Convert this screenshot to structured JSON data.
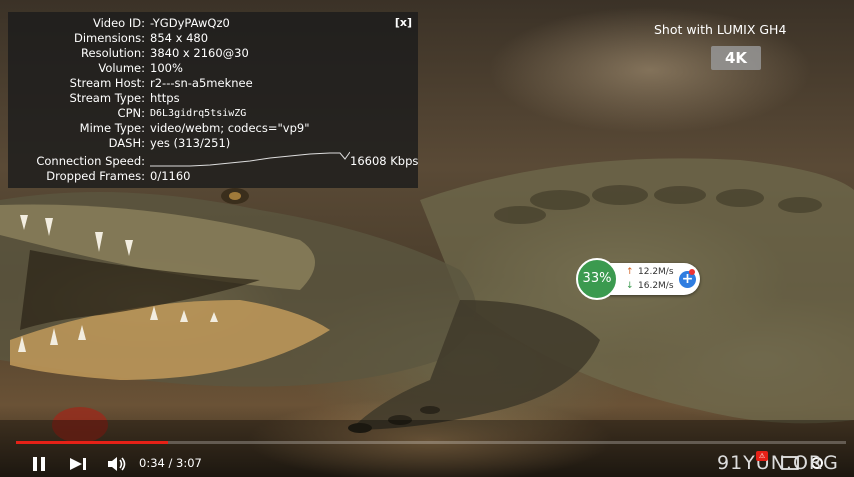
{
  "stats": {
    "close_label": "[x]",
    "rows": [
      {
        "label": "Video ID:",
        "value": "-YGDyPAwQz0"
      },
      {
        "label": "Dimensions:",
        "value": "854 x 480"
      },
      {
        "label": "Resolution:",
        "value": "3840 x 2160@30"
      },
      {
        "label": "Volume:",
        "value": "100%"
      },
      {
        "label": "Stream Host:",
        "value": "r2---sn-a5meknee"
      },
      {
        "label": "Stream Type:",
        "value": "https"
      },
      {
        "label": "CPN:",
        "value": "D6L3gidrq5tsiwZG"
      },
      {
        "label": "Mime Type:",
        "value": "video/webm; codecs=\"vp9\""
      },
      {
        "label": "DASH:",
        "value": "yes (313/251)"
      },
      {
        "label": "Connection Speed:",
        "value": "16608 Kbps"
      },
      {
        "label": "Dropped Frames:",
        "value": "0/1160"
      }
    ]
  },
  "brand": {
    "text": "Shot with LUMIX GH4",
    "badge": "4K"
  },
  "widget": {
    "percent": "33%",
    "up": "12.2M/s",
    "down": "16.2M/s"
  },
  "player": {
    "time": "0:34 / 3:07",
    "progress": 0.183,
    "accent": "#e62117"
  },
  "watermark": {
    "text": "91YUN.ORG",
    "badge": "⚠"
  }
}
